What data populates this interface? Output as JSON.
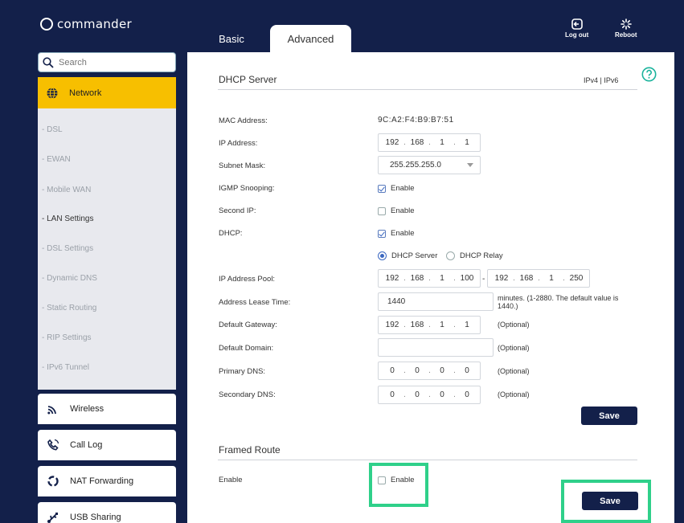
{
  "brand": "commander",
  "tabs": {
    "basic": "Basic",
    "advanced": "Advanced"
  },
  "header": {
    "logout": "Log out",
    "reboot": "Reboot"
  },
  "search": {
    "placeholder": "Search"
  },
  "sidebar": {
    "network": "Network",
    "subitems": [
      "- DSL",
      "- EWAN",
      "- Mobile WAN",
      "- LAN Settings",
      "- DSL Settings",
      "- Dynamic DNS",
      "- Static Routing",
      "- RIP Settings",
      "- IPv6 Tunnel"
    ],
    "active_subitem": "- LAN Settings",
    "wireless": "Wireless",
    "call_log": "Call Log",
    "nat_forwarding": "NAT Forwarding",
    "usb_sharing": "USB Sharing"
  },
  "dhcp": {
    "title": "DHCP Server",
    "ip_versions": "IPv4 | IPv6",
    "labels": {
      "mac": "MAC Address:",
      "ip": "IP Address:",
      "subnet": "Subnet Mask:",
      "igmp": "IGMP Snooping:",
      "second_ip": "Second IP:",
      "dhcp": "DHCP:",
      "pool": "IP Address Pool:",
      "lease": "Address Lease Time:",
      "gateway": "Default Gateway:",
      "domain": "Default Domain:",
      "primary_dns": "Primary DNS:",
      "secondary_dns": "Secondary DNS:"
    },
    "mac_value": "9C:A2:F4:B9:B7:51",
    "ip_address": [
      "192",
      "168",
      "1",
      "1"
    ],
    "subnet_mask": "255.255.255.0",
    "enable_label": "Enable",
    "igmp_checked": true,
    "second_ip_checked": false,
    "dhcp_checked": true,
    "mode_server": "DHCP Server",
    "mode_relay": "DHCP Relay",
    "mode_selected": "DHCP Server",
    "pool_start": [
      "192",
      "168",
      "1",
      "100"
    ],
    "pool_end": [
      "192",
      "168",
      "1",
      "250"
    ],
    "pool_separator": "-",
    "lease_value": "1440",
    "lease_hint": "minutes. (1-2880. The default value is 1440.)",
    "gateway": [
      "192",
      "168",
      "1",
      "1"
    ],
    "optional": "(Optional)",
    "domain_value": "",
    "primary_dns": [
      "0",
      "0",
      "0",
      "0"
    ],
    "secondary_dns": [
      "0",
      "0",
      "0",
      "0"
    ],
    "save": "Save"
  },
  "framed_route": {
    "title": "Framed Route",
    "enable_row_label": "Enable",
    "enable_label": "Enable",
    "enabled": false,
    "save": "Save"
  },
  "colors": {
    "navy": "#13204a",
    "accent_yellow": "#f7bf00",
    "highlight_green": "#2fd08a",
    "link_blue": "#3a67c0"
  }
}
